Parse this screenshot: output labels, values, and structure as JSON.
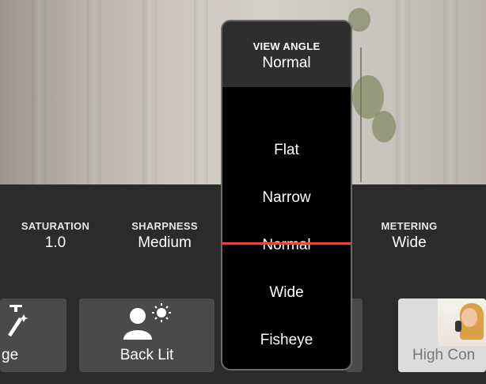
{
  "settings": {
    "saturation": {
      "label": "SATURATION",
      "value": "1.0"
    },
    "sharpness": {
      "label": "SHARPNESS",
      "value": "Medium"
    },
    "metering": {
      "label": "METERING",
      "value": "Wide"
    }
  },
  "picker": {
    "title": "VIEW ANGLE",
    "current": "Normal",
    "options": [
      "Flat",
      "Narrow",
      "Normal",
      "Wide",
      "Fisheye"
    ]
  },
  "scenes": [
    {
      "label": "ge",
      "icon": "magic-wand-icon"
    },
    {
      "label": "Back Lit",
      "icon": "backlit-person-icon"
    },
    {
      "label": "High Con",
      "icon": "singer-thumbnail"
    }
  ],
  "colors": {
    "accent_line": "#e0483a",
    "panel": "#2b2b2b",
    "picker_bg": "#000000"
  }
}
